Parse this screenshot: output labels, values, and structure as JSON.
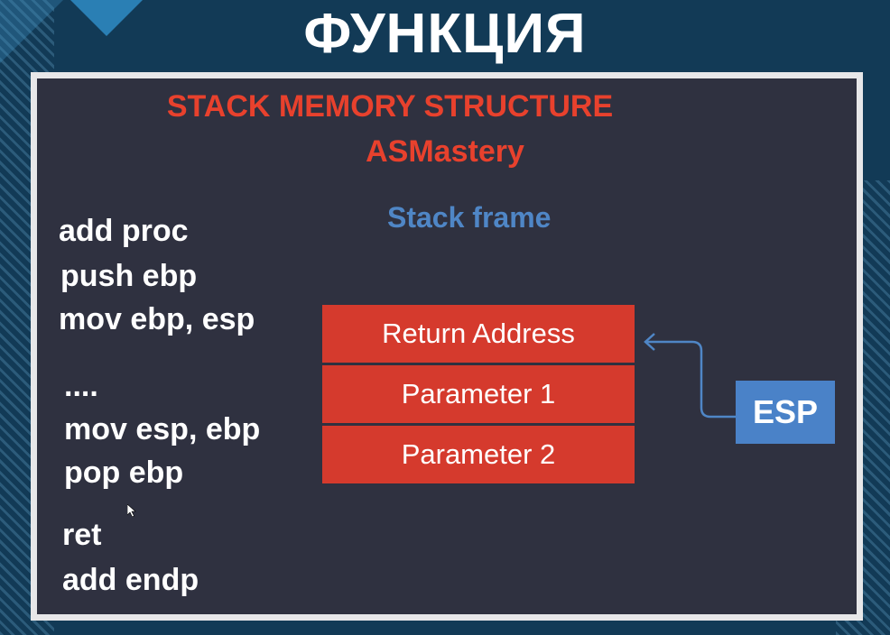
{
  "title": "ФУНКЦИЯ",
  "slide": {
    "heading": "STACK MEMORY STRUCTURE",
    "subheading": "ASMastery",
    "frame_label": "Stack frame",
    "code_lines": [
      "add proc",
      "push ebp",
      "mov ebp, esp",
      "....",
      "mov esp, ebp",
      "pop ebp",
      "ret",
      "add endp"
    ],
    "stack_cells": [
      "Return Address",
      "Parameter 1",
      "Parameter 2"
    ],
    "pointer_label": "ESP",
    "colors": {
      "heading": "#e8412d",
      "frame_label": "#4f86c6",
      "stack_cell": "#d53a2d",
      "pointer_box": "#4a82c8",
      "slide_bg": "#2f3140",
      "page_bg": "#123a56"
    },
    "icons": [
      "arrow-icon",
      "cursor-icon"
    ]
  }
}
